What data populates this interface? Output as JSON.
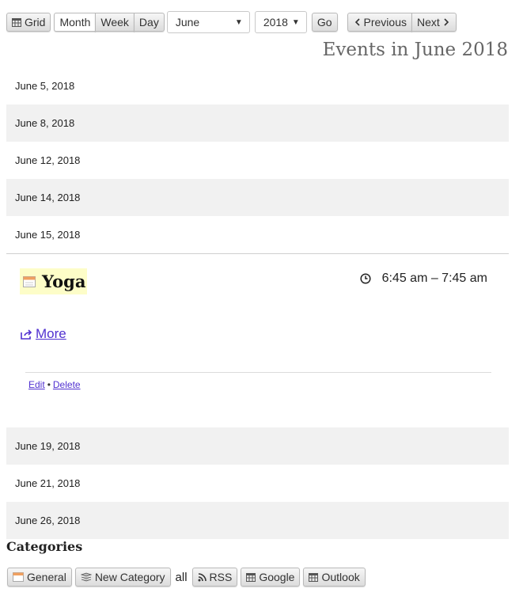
{
  "toolbar": {
    "grid_label": "Grid",
    "month_label": "Month",
    "week_label": "Week",
    "day_label": "Day",
    "month_select": "June",
    "year_select": "2018",
    "go_label": "Go",
    "previous_label": "Previous",
    "next_label": "Next"
  },
  "page_title": "Events in June 2018",
  "dates_before": [
    {
      "label": "June 5, 2018"
    },
    {
      "label": "June 8, 2018"
    },
    {
      "label": "June 12, 2018"
    },
    {
      "label": "June 14, 2018"
    },
    {
      "label": "June 15, 2018"
    }
  ],
  "event": {
    "title": "Yoga",
    "time": "6:45 am – 7:45 am",
    "more_label": "More",
    "edit_label": "Edit",
    "separator": "•",
    "delete_label": "Delete"
  },
  "dates_after": [
    {
      "label": "June 19, 2018"
    },
    {
      "label": "June 21, 2018"
    },
    {
      "label": "June 26, 2018"
    }
  ],
  "categories": {
    "heading": "Categories",
    "general_label": "General",
    "new_category_label": "New Category",
    "all_label": "all",
    "rss_label": "RSS",
    "google_label": "Google",
    "outlook_label": "Outlook"
  },
  "colors": {
    "event_highlight": "#fdfdc8",
    "link": "#5030d0",
    "alt_row": "#f1f1f1"
  }
}
